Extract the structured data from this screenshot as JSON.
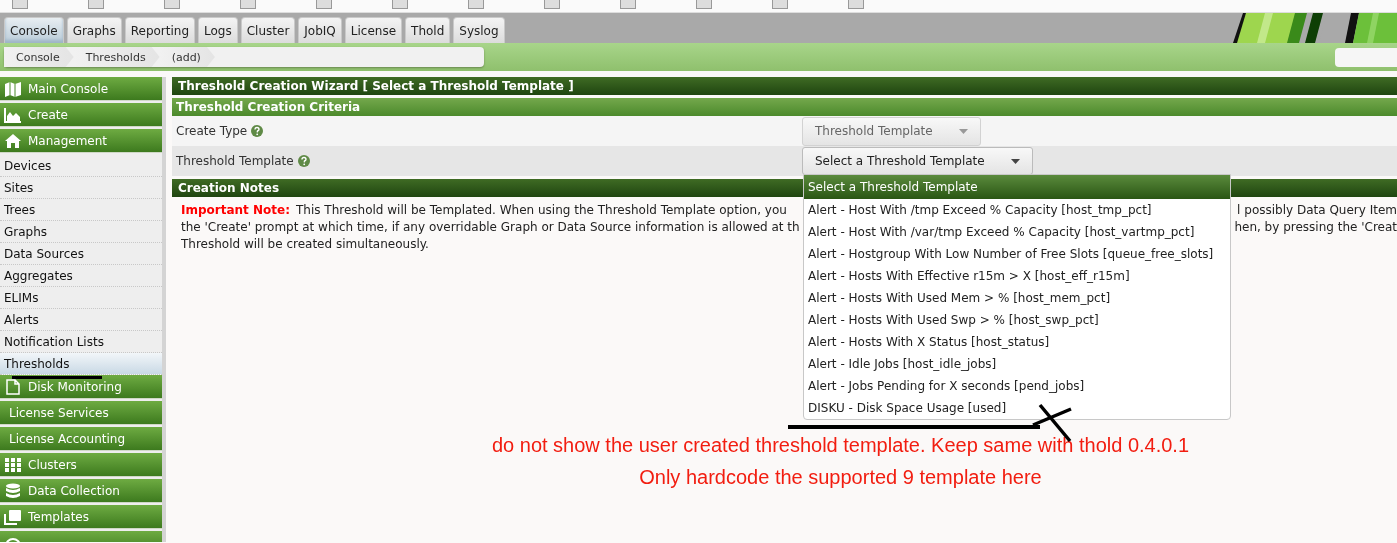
{
  "tabs": [
    {
      "label": "Console",
      "selected": true
    },
    {
      "label": "Graphs",
      "selected": false
    },
    {
      "label": "Reporting",
      "selected": false
    },
    {
      "label": "Logs",
      "selected": false
    },
    {
      "label": "Cluster",
      "selected": false
    },
    {
      "label": "JobIQ",
      "selected": false
    },
    {
      "label": "License",
      "selected": false
    },
    {
      "label": "Thold",
      "selected": false
    },
    {
      "label": "Syslog",
      "selected": false
    }
  ],
  "breadcrumb": [
    "Console",
    "Thresholds",
    "(add)"
  ],
  "sidebar": {
    "items": [
      {
        "kind": "header",
        "label": "Main Console",
        "selected": false
      },
      {
        "kind": "header",
        "label": "Create",
        "selected": false
      },
      {
        "kind": "header",
        "label": "Management",
        "selected": false
      },
      {
        "kind": "item",
        "label": "Devices",
        "selected": false
      },
      {
        "kind": "item",
        "label": "Sites",
        "selected": false
      },
      {
        "kind": "item",
        "label": "Trees",
        "selected": false
      },
      {
        "kind": "item",
        "label": "Graphs",
        "selected": false
      },
      {
        "kind": "item",
        "label": "Data Sources",
        "selected": false
      },
      {
        "kind": "item",
        "label": "Aggregates",
        "selected": false
      },
      {
        "kind": "item",
        "label": "ELIMs",
        "selected": false
      },
      {
        "kind": "item",
        "label": "Alerts",
        "selected": false
      },
      {
        "kind": "item",
        "label": "Notification Lists",
        "selected": false
      },
      {
        "kind": "item",
        "label": "Thresholds",
        "selected": true
      },
      {
        "kind": "header",
        "label": "Disk Monitoring",
        "selected": false
      },
      {
        "kind": "subheader",
        "label": "License Services",
        "selected": false
      },
      {
        "kind": "subheader",
        "label": "License Accounting",
        "selected": false
      },
      {
        "kind": "header",
        "label": "Clusters",
        "selected": false
      },
      {
        "kind": "header",
        "label": "Data Collection",
        "selected": false
      },
      {
        "kind": "header",
        "label": "Templates",
        "selected": false
      },
      {
        "kind": "header",
        "selected": false
      }
    ]
  },
  "wizard": {
    "title": "Threshold Creation Wizard [ Select a Threshold Template ]",
    "criteria_title": "Threshold Creation Criteria",
    "fields": [
      {
        "label": "Create Type",
        "value": "Threshold Template",
        "disabled": true
      },
      {
        "label": "Threshold Template",
        "value": "Select a Threshold Template",
        "disabled": false
      }
    ],
    "notes_title": "Creation Notes",
    "note": {
      "label": "Important Note:",
      "lines": [
        {
          "left": "This Threshold will be Templated. When using the Threshold Template option, you",
          "right": "l possibly Data Query Item"
        },
        {
          "left": "the 'Create' prompt at which time, if any overridable Graph or Data Source information is allowed at th",
          "right": "hen, by pressing the 'Creat"
        },
        {
          "left": "Threshold will be created simultaneously."
        }
      ]
    },
    "dropdown": {
      "options": [
        {
          "label": "Select a Threshold Template",
          "selected": true
        },
        {
          "label": "Alert - Host With /tmp Exceed % Capacity [host_tmp_pct]",
          "selected": false
        },
        {
          "label": "Alert - Host With /var/tmp Exceed % Capacity [host_vartmp_pct]",
          "selected": false
        },
        {
          "label": "Alert - Hostgroup With Low Number of Free Slots [queue_free_slots]",
          "selected": false
        },
        {
          "label": "Alert - Hosts With Effective r15m > X [host_eff_r15m]",
          "selected": false
        },
        {
          "label": "Alert - Hosts With Used Mem > % [host_mem_pct]",
          "selected": false
        },
        {
          "label": "Alert - Hosts With Used Swp > % [host_swp_pct]",
          "selected": false
        },
        {
          "label": "Alert - Hosts With X Status [host_status]",
          "selected": false
        },
        {
          "label": "Alert - Idle Jobs [host_idle_jobs]",
          "selected": false
        },
        {
          "label": "Alert - Jobs Pending for X seconds [pend_jobs]",
          "selected": false
        },
        {
          "label": "DISKU - Disk Space Usage [used]",
          "selected": false
        }
      ]
    }
  },
  "annotations": [
    "do not show the user created threshold template. Keep same with thold 0.4.0.1",
    "Only hardcode the supported 9 template here"
  ]
}
